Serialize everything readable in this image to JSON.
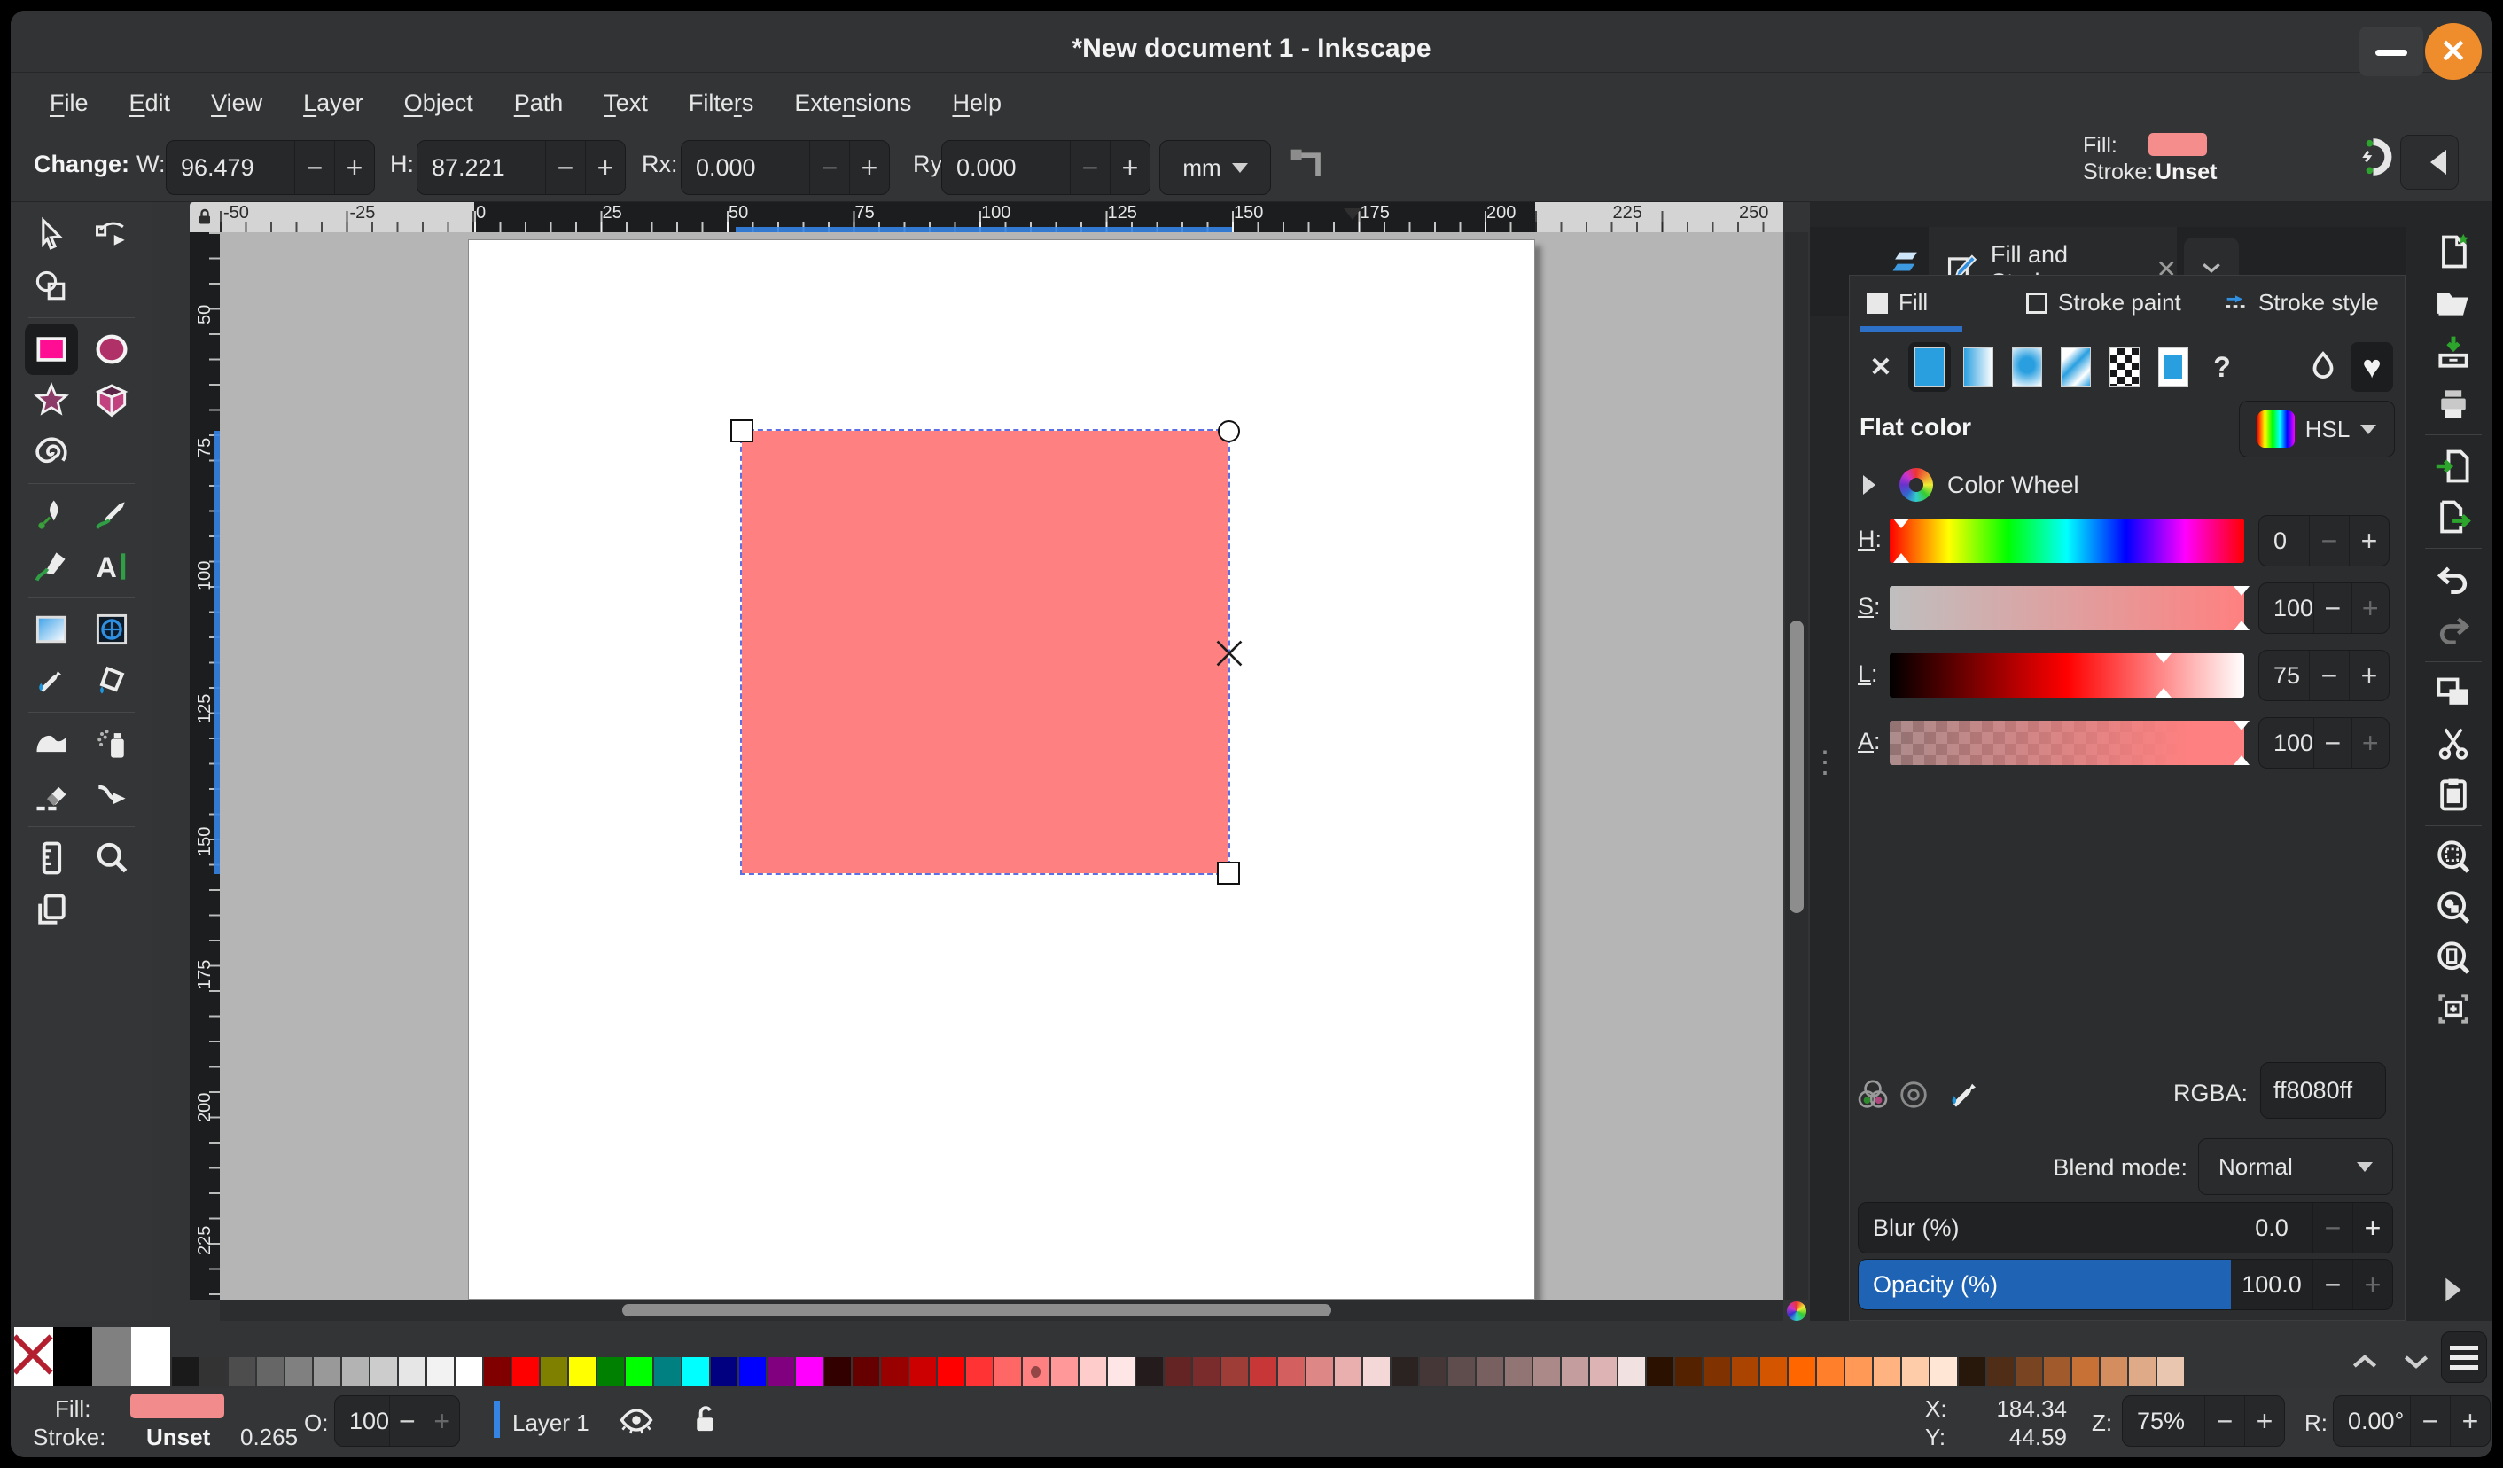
{
  "window": {
    "title": "*New document 1 - Inkscape"
  },
  "menubar": {
    "items": [
      {
        "label": "File",
        "u": 0
      },
      {
        "label": "Edit",
        "u": 0
      },
      {
        "label": "View",
        "u": 0
      },
      {
        "label": "Layer",
        "u": 0
      },
      {
        "label": "Object",
        "u": 0
      },
      {
        "label": "Path",
        "u": 0
      },
      {
        "label": "Text",
        "u": 0
      },
      {
        "label": "Filters",
        "u": 5
      },
      {
        "label": "Extensions",
        "u": 4
      },
      {
        "label": "Help",
        "u": 0
      }
    ]
  },
  "toolbar": {
    "change_label": "Change:",
    "w_label": "W:",
    "w_value": "96.479",
    "h_label": "H:",
    "h_value": "87.221",
    "rx_label": "Rx:",
    "rx_value": "0.000",
    "ry_label": "Ry:",
    "ry_value": "0.000",
    "unit": "mm"
  },
  "selection_indicator": {
    "fill_label": "Fill:",
    "stroke_label": "Stroke:",
    "stroke_value": "Unset",
    "fill_color": "#ff8080"
  },
  "rulers": {
    "horizontal": [
      "-50",
      "-25",
      "0",
      "25",
      "50",
      "75",
      "100",
      "125",
      "150",
      "175",
      "200",
      "225",
      "250"
    ],
    "vertical": [
      "50",
      "75",
      "100",
      "125",
      "150",
      "175",
      "200",
      "225"
    ]
  },
  "toolbox": {
    "tools": [
      {
        "name": "selector-tool",
        "icon": "sel"
      },
      {
        "name": "node-tool",
        "icon": "node"
      },
      {
        "name": "shape-builder-tool",
        "icon": "sbuild"
      },
      {
        "spacer": true
      },
      {
        "sep": true
      },
      {
        "name": "rectangle-tool",
        "icon": "rect",
        "active": true
      },
      {
        "name": "ellipse-tool",
        "icon": "ellipse"
      },
      {
        "name": "star-tool",
        "icon": "star"
      },
      {
        "name": "box3d-tool",
        "icon": "box3d"
      },
      {
        "name": "spiral-tool",
        "icon": "spiral"
      },
      {
        "spacer": true
      },
      {
        "sep": true
      },
      {
        "name": "pen-tool",
        "icon": "pen"
      },
      {
        "name": "pencil-tool",
        "icon": "pencil"
      },
      {
        "name": "calligraphy-tool",
        "icon": "callig"
      },
      {
        "name": "text-tool",
        "icon": "text"
      },
      {
        "sep": true
      },
      {
        "name": "gradient-tool",
        "icon": "grad"
      },
      {
        "name": "mesh-gradient-tool",
        "icon": "mesh"
      },
      {
        "name": "dropper-tool",
        "icon": "dropper"
      },
      {
        "name": "paint-bucket-tool",
        "icon": "bucket"
      },
      {
        "sep": true
      },
      {
        "name": "tweak-tool",
        "icon": "tweak"
      },
      {
        "name": "spray-tool",
        "icon": "spray"
      },
      {
        "name": "eraser-tool",
        "icon": "eraser"
      },
      {
        "name": "connector-tool",
        "icon": "connector"
      },
      {
        "sep": true
      },
      {
        "name": "measure-tool",
        "icon": "measure"
      },
      {
        "name": "zoom-tool",
        "icon": "zoom"
      },
      {
        "name": "pages-tool",
        "icon": "pages"
      }
    ]
  },
  "commands": [
    {
      "name": "new-document",
      "icon": "docnew"
    },
    {
      "name": "open-document",
      "icon": "open"
    },
    {
      "name": "save-document",
      "icon": "save"
    },
    {
      "name": "print",
      "icon": "print"
    },
    {
      "sep": true
    },
    {
      "name": "import",
      "icon": "import"
    },
    {
      "name": "export",
      "icon": "export"
    },
    {
      "sep": true
    },
    {
      "name": "undo",
      "icon": "undo"
    },
    {
      "name": "redo",
      "icon": "redo",
      "disabled": true
    },
    {
      "sep": true
    },
    {
      "name": "copy",
      "icon": "copy"
    },
    {
      "name": "cut",
      "icon": "cut"
    },
    {
      "name": "paste",
      "icon": "paste"
    },
    {
      "sep": true
    },
    {
      "name": "zoom-selection",
      "icon": "zoomsel"
    },
    {
      "name": "zoom-drawing",
      "icon": "zoomdraw"
    },
    {
      "name": "zoom-page",
      "icon": "zoompage"
    },
    {
      "name": "zoom-center-page",
      "icon": "zoomcenter"
    }
  ],
  "dock": {
    "panel_tab": "Fill and Stroke",
    "tabs": [
      {
        "label": "Fill"
      },
      {
        "label": "Stroke paint"
      },
      {
        "label": "Stroke style"
      }
    ],
    "fill_types": [
      {
        "name": "no-paint"
      },
      {
        "name": "flat-color",
        "active": true
      },
      {
        "name": "linear-gradient"
      },
      {
        "name": "radial-gradient"
      },
      {
        "name": "mesh-gradient"
      },
      {
        "name": "pattern"
      },
      {
        "name": "swatch"
      },
      {
        "name": "unknown-paint"
      },
      {
        "name": "fill-rule-even-odd",
        "gap": true
      },
      {
        "name": "fill-rule-nonzero",
        "active": true
      }
    ],
    "paint_type": "Flat color",
    "picker_mode": "HSL",
    "color_wheel_label": "Color Wheel",
    "sliders": [
      {
        "label": "H:",
        "value": "0",
        "pct": 1,
        "kind": "h",
        "dim": "minus"
      },
      {
        "label": "S:",
        "value": "100",
        "pct": 97,
        "kind": "s",
        "dim": "plus"
      },
      {
        "label": "L:",
        "value": "75",
        "pct": 75,
        "kind": "l",
        "dim": "none"
      },
      {
        "label": "A:",
        "value": "100",
        "pct": 97,
        "kind": "a",
        "dim": "plus"
      }
    ],
    "rgba_label": "RGBA:",
    "rgba_value": "ff8080ff",
    "blend_label": "Blend mode:",
    "blend_value": "Normal",
    "blur_label": "Blur (%)",
    "blur_value": "0.0",
    "opacity_label": "Opacity (%)",
    "opacity_value": "100.0",
    "accent": "#2d70c8"
  },
  "palette": {
    "big": [
      {
        "name": "no-color"
      },
      {
        "color": "#000000"
      },
      {
        "color": "#808080"
      },
      {
        "color": "#ffffff"
      }
    ],
    "selected": "#ff8080",
    "colors": [
      "#1a1a1a",
      "#333333",
      "#4d4d4d",
      "#666666",
      "#808080",
      "#999999",
      "#b3b3b3",
      "#cccccc",
      "#e6e6e6",
      "#f2f2f2",
      "#ffffff",
      "#800000",
      "#ff0000",
      "#808000",
      "#ffff00",
      "#008000",
      "#00ff00",
      "#008080",
      "#00ffff",
      "#000080",
      "#0000ff",
      "#800080",
      "#ff00ff",
      "#330000",
      "#660000",
      "#990000",
      "#cc0000",
      "#ff0000",
      "#ff3333",
      "#ff6666",
      "#ff8080",
      "#ff9999",
      "#ffcccc",
      "#ffe6e6",
      "#241c1c",
      "#632423",
      "#7a2b2b",
      "#9e3c38",
      "#c83737",
      "#d35f5f",
      "#de8787",
      "#e9afaf",
      "#f4d7d7",
      "#2b2222",
      "#453737",
      "#5f4c4c",
      "#786060",
      "#917575",
      "#ab8989",
      "#c49e9e",
      "#ddb3b3",
      "#f1e1e1",
      "#2b1100",
      "#552200",
      "#803300",
      "#aa4400",
      "#d45500",
      "#ff6600",
      "#ff7f2a",
      "#ff9955",
      "#ffb380",
      "#ffccaa",
      "#ffe6d5",
      "#28170b",
      "#502d16",
      "#784421",
      "#a05a2c",
      "#c87137",
      "#d38d5f",
      "#deaa87",
      "#e9c6af"
    ]
  },
  "status": {
    "fill_label": "Fill:",
    "stroke_label": "Stroke:",
    "stroke_value": "Unset",
    "stroke_width": "0.265",
    "opacity_label": "O:",
    "opacity_value": "100",
    "layer_label": "Layer 1",
    "x_label": "X:",
    "x_value": "184.34",
    "y_label": "Y:",
    "y_value": "44.59",
    "zoom_label": "Z:",
    "zoom_value": "75%",
    "rotation_label": "R:",
    "rotation_value": "0.00°"
  },
  "canvas": {
    "selection_fill": "#ff8080"
  }
}
